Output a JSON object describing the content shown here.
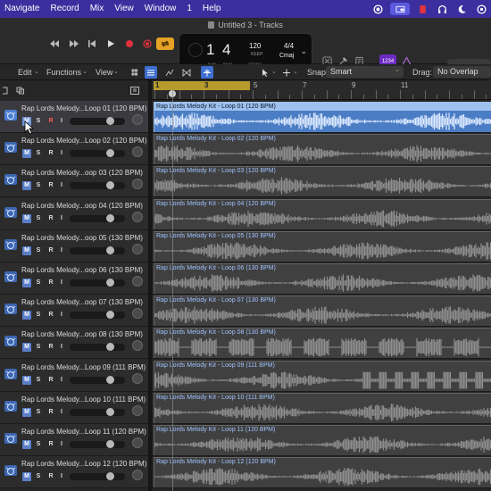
{
  "menubar": {
    "items": [
      "Navigate",
      "Record",
      "Mix",
      "View",
      "Window",
      "1",
      "Help"
    ],
    "tray_icons": [
      "record-dot-icon",
      "screen-icon",
      "red-square-icon",
      "headphones-icon",
      "moon-icon",
      "control-center-icon"
    ]
  },
  "window": {
    "title": "Untitled 3 - Tracks"
  },
  "transport": {
    "bar": "1",
    "beat": "4",
    "bar_label": "BAR",
    "beat_label": "BEAT",
    "tempo": "120",
    "tempo_mode": "KEEP",
    "tempo_label": "TEMPO",
    "time_signature": "4/4",
    "key": "Cmaj"
  },
  "counter_badge": "1234",
  "toolbar": {
    "edit": "Edit",
    "functions": "Functions",
    "view": "View",
    "snap_label": "Snap:",
    "snap_value": "Smart",
    "drag_label": "Drag:",
    "drag_value": "No Overlap"
  },
  "ruler": {
    "bars": [
      "1",
      "3",
      "5",
      "7",
      "9",
      "11"
    ]
  },
  "buttons": {
    "mute": "M",
    "solo": "S",
    "record": "R",
    "input": "I"
  },
  "tracks": [
    {
      "name": "Rap Lords Melody...Loop 01 (120 BPM)",
      "region": "Rap Lords Melody Kit - Loop 01 (120 BPM)"
    },
    {
      "name": "Rap Lords Melody...Loop 02 (120 BPM)",
      "region": "Rap Lords Melody Kit - Loop 02 (120 BPM)"
    },
    {
      "name": "Rap Lords Melody...oop 03 (120 BPM)",
      "region": "Rap Lords Melody Kit - Loop 03 (120 BPM)"
    },
    {
      "name": "Rap Lords Melody...oop 04 (120 BPM)",
      "region": "Rap Lords Melody Kit - Loop 04 (120 BPM)"
    },
    {
      "name": "Rap Lords Melody...oop 05 (130 BPM)",
      "region": "Rap Lords Melody Kit - Loop 05 (130 BPM)"
    },
    {
      "name": "Rap Lords Melody...oop 06 (130 BPM)",
      "region": "Rap Lords Melody Kit - Loop 06 (130 BPM)"
    },
    {
      "name": "Rap Lords Melody...oop 07 (130 BPM)",
      "region": "Rap Lords Melody Kit - Loop 07 (130 BPM)"
    },
    {
      "name": "Rap Lords Melody...oop 08 (130 BPM)",
      "region": "Rap Lords Melody Kit - Loop 08 (130 BPM)"
    },
    {
      "name": "Rap Lords Melody...Loop 09 (111 BPM)",
      "region": "Rap Lords Melody Kit - Loop 09 (111 BPM)"
    },
    {
      "name": "Rap Lords Melody...Loop 10 (111 BPM)",
      "region": "Rap Lords Melody Kit - Loop 10 (111 BPM)"
    },
    {
      "name": "Rap Lords Melody...Loop 11 (120 BPM)",
      "region": "Rap Lords Melody Kit - Loop 11 (120 BPM)"
    },
    {
      "name": "Rap Lords Melody...Loop 12 (120 BPM)",
      "region": "Rap Lords Melody Kit - Loop 12 (120 BPM)"
    }
  ],
  "colors": {
    "menubar": "#3b2e9e",
    "selected_region": "#4b7dc4",
    "region": "#404040",
    "mute_button": "#5a7ec9",
    "cycle": "#b79a2c",
    "record": "#e0333d",
    "cycle_button": "#e5a126"
  }
}
